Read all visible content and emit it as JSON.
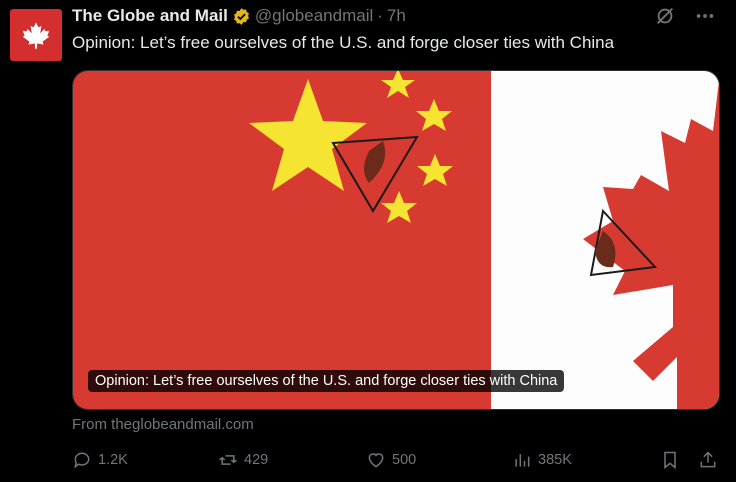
{
  "account": {
    "name": "The Globe and Mail",
    "handle": "@globeandmail",
    "separator": "·",
    "time": "7h"
  },
  "tweet": {
    "text": "Opinion: Let’s free ourselves of the U.S. and forge closer ties with China"
  },
  "card": {
    "caption": "Opinion: Let’s free ourselves of the U.S. and forge closer ties with China",
    "source": "From theglobeandmail.com"
  },
  "actions": {
    "replies": "1.2K",
    "reposts": "429",
    "likes": "500",
    "views": "385K"
  },
  "colors": {
    "flag_red": "#d63a30",
    "star_yellow": "#f5e431",
    "muted_text": "#71767b",
    "verified_gold": "#e2b719"
  },
  "icons": [
    "maple-leaf-icon",
    "verified-badge-icon",
    "grok-icon",
    "more-icon",
    "reply-icon",
    "repost-icon",
    "like-icon",
    "views-icon",
    "bookmark-icon",
    "share-icon"
  ]
}
